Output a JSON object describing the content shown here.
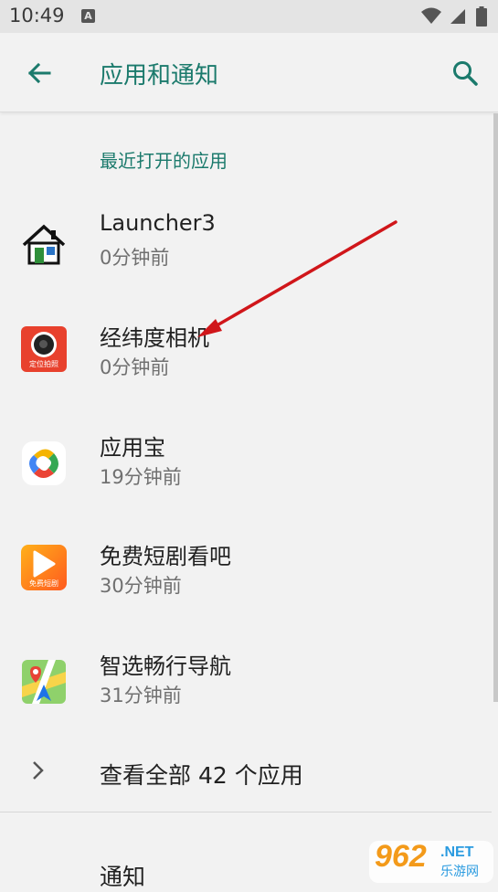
{
  "status_bar": {
    "time": "10:49",
    "notif_letter": "A"
  },
  "app_bar": {
    "title": "应用和通知",
    "back_icon": "arrow-back-icon",
    "search_icon": "search-icon"
  },
  "section_header": "最近打开的应用",
  "recent_apps": [
    {
      "name": "Launcher3",
      "time": "0分钟前",
      "icon": "house-icon"
    },
    {
      "name": "经纬度相机",
      "time": "0分钟前",
      "icon": "camera-app-icon",
      "icon_caption": "定位拍照"
    },
    {
      "name": "应用宝",
      "time": "19分钟前",
      "icon": "yingyongbao-icon"
    },
    {
      "name": "免费短剧看吧",
      "time": "30分钟前",
      "icon": "play-app-icon",
      "icon_caption": "免费短剧"
    },
    {
      "name": "智选畅行导航",
      "time": "31分钟前",
      "icon": "map-navigation-icon"
    }
  ],
  "see_all": "查看全部 42 个应用",
  "notifications_label": "通知",
  "watermark": {
    "text": "962",
    "suffix": ".NET",
    "sub": "乐游网"
  },
  "colors": {
    "accent": "#1b7a6c",
    "background": "#f2f2f2",
    "annotation_arrow": "#d0161a"
  }
}
